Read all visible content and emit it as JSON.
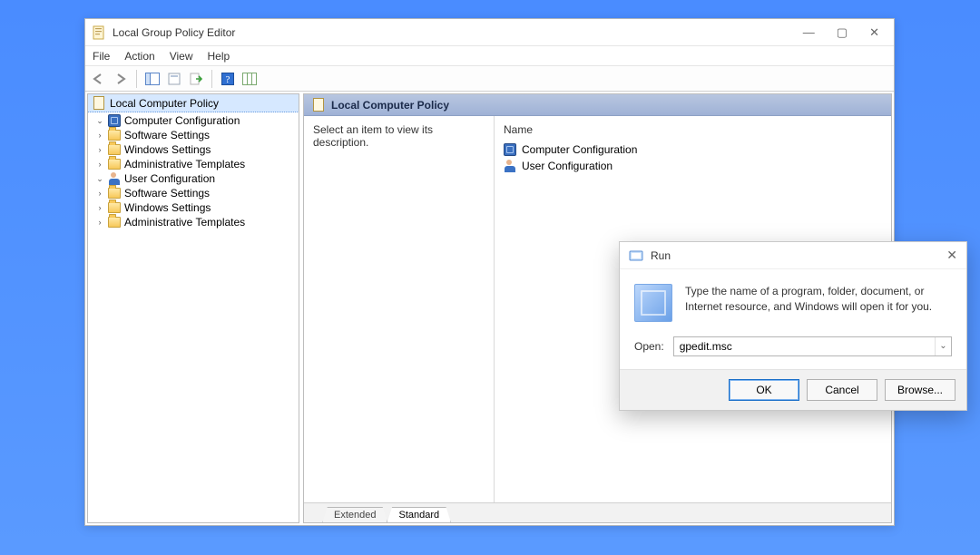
{
  "main_window": {
    "title": "Local Group Policy Editor",
    "menu": [
      "File",
      "Action",
      "View",
      "Help"
    ],
    "tree": {
      "root": "Local Computer Policy",
      "nodes": [
        {
          "label": "Computer Configuration",
          "icon": "cfg",
          "children": [
            "Software Settings",
            "Windows Settings",
            "Administrative Templates"
          ]
        },
        {
          "label": "User Configuration",
          "icon": "user",
          "children": [
            "Software Settings",
            "Windows Settings",
            "Administrative Templates"
          ]
        }
      ]
    },
    "content": {
      "header": "Local Computer Policy",
      "description_prompt": "Select an item to view its description.",
      "list_header": "Name",
      "items": [
        {
          "label": "Computer Configuration",
          "icon": "cfg"
        },
        {
          "label": "User Configuration",
          "icon": "user"
        }
      ]
    },
    "tabs": {
      "extended": "Extended",
      "standard": "Standard",
      "active": "standard"
    }
  },
  "run_dialog": {
    "title": "Run",
    "text": "Type the name of a program, folder, document, or Internet resource, and Windows will open it for you.",
    "open_label": "Open:",
    "open_value": "gpedit.msc",
    "buttons": {
      "ok": "OK",
      "cancel": "Cancel",
      "browse": "Browse..."
    }
  }
}
